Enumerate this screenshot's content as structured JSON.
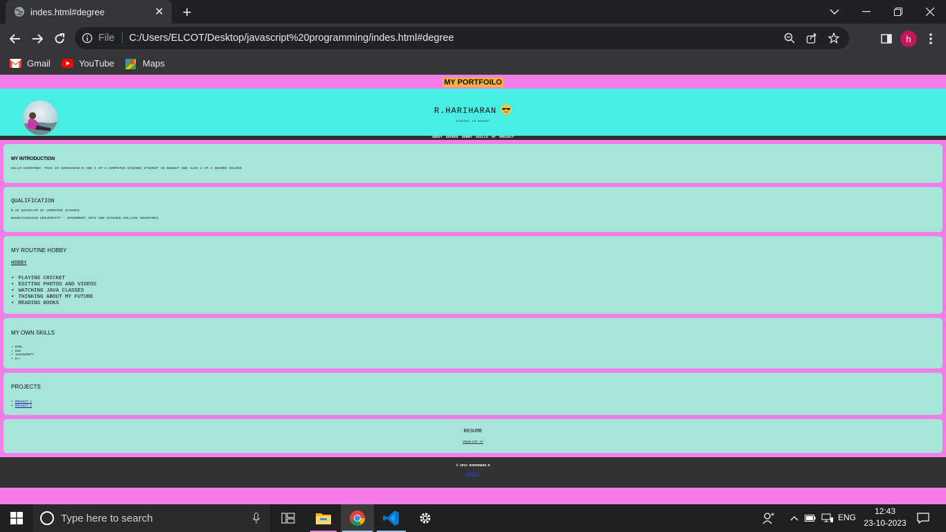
{
  "browser": {
    "tab_title": "indes.html#degree",
    "scheme_label": "File",
    "url": "C:/Users/ELCOT/Desktop/javascript%20programming/indes.html#degree",
    "profile_initial": "h",
    "bookmarks": [
      {
        "label": "Gmail",
        "icon": "gmail-icon"
      },
      {
        "label": "YouTube",
        "icon": "youtube-icon"
      },
      {
        "label": "Maps",
        "icon": "maps-icon"
      }
    ]
  },
  "site": {
    "title": "MY PORTFOILO",
    "name": "R.HARIHARAN",
    "name_emoji": "sunglasses-emoji",
    "subtitle": "STUDENT IN BDUKHT",
    "nav": [
      "ABOUT",
      "DEGREE",
      "HOBBY",
      "SKILLS",
      "MY",
      "PROJECT"
    ]
  },
  "intro": {
    "heading": "MY INTRODUCTION",
    "text": "HELLO EVERYONE! THIS IS HARIHARAN.R AND I AM A COMPUTER SCIENCE STUDENT IN BDUKHT AND ALSO I AM A DEGREE HOLDER"
  },
  "qualification": {
    "heading": "QUALIFICATION",
    "line1": "B.SC BACHELOR OF COMPUTER SCIENCE",
    "line2": "BHARATHIDASAN UNIVERSITY - GOVERMENT ARTS AND SCIENCE COLLAGE ARANTANGI"
  },
  "hobby": {
    "heading": "MY ROUTINE HOBBY",
    "subheading": "HOBBY",
    "items": [
      "PLAYING CRICKET",
      "EDITING PHOTOS AND VIDEOS",
      "WATCHING JAVA CLASSES",
      "THINKING ABOUT MY FUTURE",
      "READING BOOKS"
    ]
  },
  "skills": {
    "heading": "MY OWN SKILLS",
    "items": [
      "HTML",
      "CSS",
      "JAVASCRIPT",
      "C++"
    ]
  },
  "projects": {
    "heading": "PROJECTS",
    "items": [
      "PROJECT 1",
      "PROJECT 2"
    ]
  },
  "resume": {
    "heading": "RESUME",
    "link": "DOWNLOAD CV"
  },
  "footer": {
    "copyright": "© 2023 HARIHARAN.R",
    "link": "CONTACT"
  },
  "taskbar": {
    "search_placeholder": "Type here to search",
    "language": "ENG",
    "time": "12:43",
    "date": "23-10-2023"
  },
  "colors": {
    "page_bg": "#f27ce8",
    "hero_bg": "#48ede4",
    "card_bg": "#a8e4da",
    "title_highlight": "#f5b13e"
  }
}
